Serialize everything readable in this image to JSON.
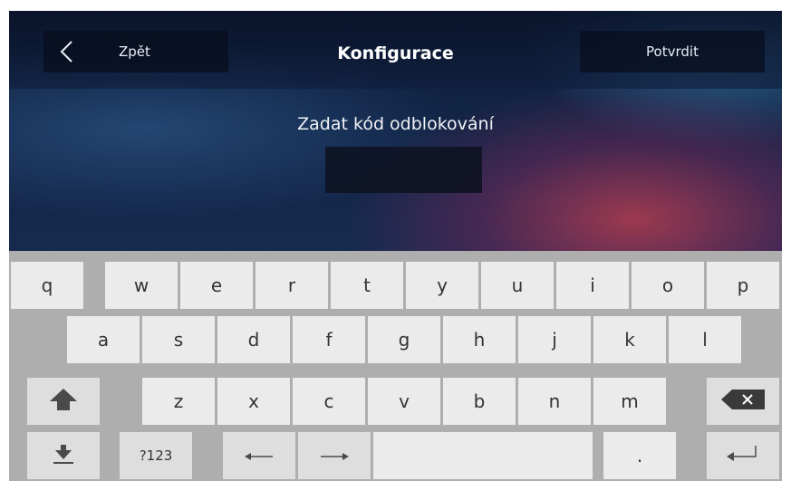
{
  "header": {
    "back_label": "Zpět",
    "title": "Konfigurace",
    "confirm_label": "Potvrdit"
  },
  "prompt": {
    "label": "Zadat kód odblokování",
    "code_value": ""
  },
  "keyboard": {
    "row1": [
      "q",
      "w",
      "e",
      "r",
      "t",
      "y",
      "u",
      "i",
      "o",
      "p"
    ],
    "row2": [
      "a",
      "s",
      "d",
      "f",
      "g",
      "h",
      "j",
      "k",
      "l"
    ],
    "row3": [
      "z",
      "x",
      "c",
      "v",
      "b",
      "n",
      "m"
    ],
    "symbols_label": "?123",
    "period_label": ".",
    "icons": {
      "shift": "shift-up-arrow-icon",
      "backspace": "backspace-icon",
      "hide": "keyboard-hide-icon",
      "left": "arrow-left-icon",
      "right": "arrow-right-icon",
      "enter": "enter-return-icon"
    }
  },
  "colors": {
    "keyboard_bg": "#aeaeae",
    "key_bg": "#ebebeb",
    "key_text": "#333333",
    "topbar_button_bg": "#0c1428"
  }
}
